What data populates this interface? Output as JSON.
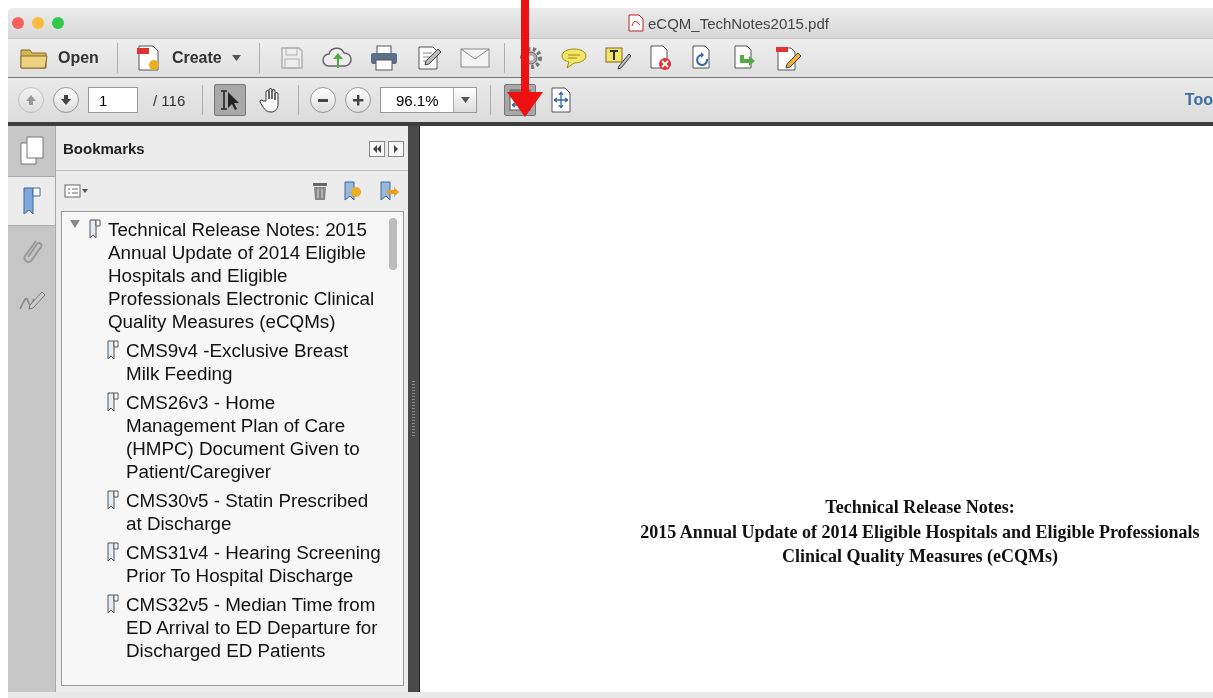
{
  "window": {
    "title": "eCQM_TechNotes2015.pdf"
  },
  "toolbar": {
    "open_label": "Open",
    "create_label": "Create",
    "save_disabled": true
  },
  "navigation": {
    "previous_disabled": true,
    "page": "1",
    "page_total": "/ 116",
    "zoom": "96.1%",
    "tools_label": "Too"
  },
  "tools": [
    {
      "kind": "select",
      "selected": true
    },
    {
      "kind": "hand",
      "selected": false
    }
  ],
  "view_buttons": [
    {
      "kind": "fit-width",
      "selected": true
    },
    {
      "kind": "fit-page",
      "selected": false
    }
  ],
  "side_tabs": [
    {
      "kind": "pages",
      "selected": false
    },
    {
      "kind": "bookmarks",
      "selected": true
    },
    {
      "kind": "attachments",
      "selected": false
    },
    {
      "kind": "signatures",
      "selected": false
    }
  ],
  "bookmarks": {
    "title": "Bookmarks",
    "items": [
      {
        "label": "Technical Release Notes: 2015 Annual Update of 2014 Eligible Hospitals and Eligible Professionals Electronic Clinical Quality Measures (eCQMs)",
        "expanded": true,
        "children": [
          {
            "label": "CMS9v4 -Exclusive Breast Milk Feeding"
          },
          {
            "label": "CMS26v3 - Home Management Plan of Care (HMPC) Document Given to Patient/Caregiver"
          },
          {
            "label": "CMS30v5 - Statin Prescribed at Discharge"
          },
          {
            "label": "CMS31v4 - Hearing Screening Prior To Hospital Discharge"
          },
          {
            "label": "CMS32v5 - Median Time from ED Arrival to ED Departure for Discharged ED Patients"
          }
        ]
      }
    ]
  },
  "document": {
    "heading_lines": [
      "Technical Release Notes:",
      "2015 Annual Update of 2014 Eligible Hospitals and Eligible Professionals",
      "Clinical Quality Measures (eCQMs)"
    ]
  }
}
